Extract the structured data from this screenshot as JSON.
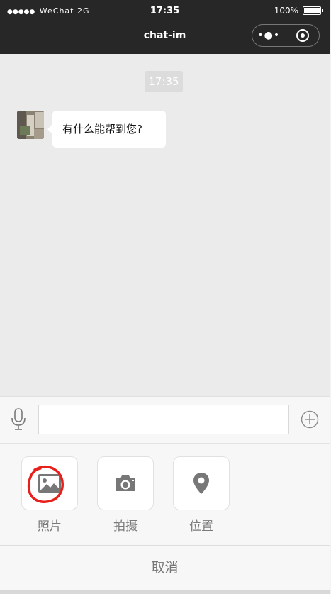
{
  "status_bar": {
    "signal_dots": "●●●●●",
    "carrier": "WeChat 2G",
    "time": "17:35",
    "battery": "100%"
  },
  "title_bar": {
    "title": "chat-im",
    "more_icon": "more-dots-icon",
    "close_icon": "target-close-icon"
  },
  "chat": {
    "timestamp": "17:35",
    "messages": [
      {
        "sender": "bot",
        "text": "有什么能帮到您?"
      }
    ]
  },
  "input_bar": {
    "voice_icon": "microphone-icon",
    "plus_icon": "plus-circle-icon",
    "text_value": ""
  },
  "tools": [
    {
      "label": "照片",
      "icon": "image-icon",
      "annotated": true
    },
    {
      "label": "拍摄",
      "icon": "camera-icon"
    },
    {
      "label": "位置",
      "icon": "location-pin-icon"
    }
  ],
  "cancel_label": "取消",
  "colors": {
    "title_bar": "#272727",
    "chat_bg": "#ebebeb",
    "panel_bg": "#f7f7f7",
    "icon_gray": "#777777",
    "annotation_red": "#e8201c"
  }
}
